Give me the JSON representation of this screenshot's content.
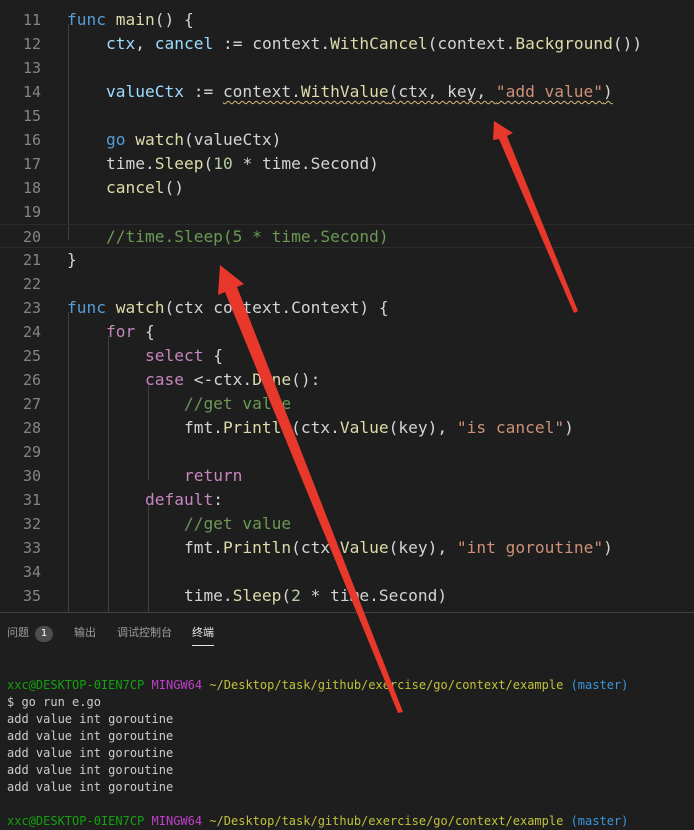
{
  "editor": {
    "lines": [
      {
        "num": "11",
        "tokens": [
          [
            "func",
            "kw"
          ],
          [
            " ",
            "pl"
          ],
          [
            "main",
            "fn"
          ],
          [
            "() {",
            "pl"
          ]
        ]
      },
      {
        "num": "12",
        "tokens": [
          [
            "    ",
            "pl"
          ],
          [
            "ctx",
            "var"
          ],
          [
            ", ",
            "pl"
          ],
          [
            "cancel",
            "var"
          ],
          [
            " := context.",
            "pl"
          ],
          [
            "WithCancel",
            "fn"
          ],
          [
            "(context.",
            "pl"
          ],
          [
            "Background",
            "fn"
          ],
          [
            "())",
            "pl"
          ]
        ]
      },
      {
        "num": "13",
        "tokens": []
      },
      {
        "num": "14",
        "tokens": [
          [
            "    ",
            "pl"
          ],
          [
            "valueCtx",
            "var"
          ],
          [
            " := ",
            "pl"
          ],
          [
            "context.",
            "pl",
            "squig"
          ],
          [
            "WithValue",
            "fn",
            "squig"
          ],
          [
            "(ctx, key, ",
            "pl",
            "squig"
          ],
          [
            "\"add value\"",
            "str",
            "squig"
          ],
          [
            ")",
            "pl",
            "squig"
          ]
        ]
      },
      {
        "num": "15",
        "tokens": []
      },
      {
        "num": "16",
        "tokens": [
          [
            "    ",
            "pl"
          ],
          [
            "go",
            "kw"
          ],
          [
            " ",
            "pl"
          ],
          [
            "watch",
            "fn"
          ],
          [
            "(valueCtx)",
            "pl"
          ]
        ]
      },
      {
        "num": "17",
        "tokens": [
          [
            "    time.",
            "pl"
          ],
          [
            "Sleep",
            "fn"
          ],
          [
            "(",
            "pl"
          ],
          [
            "10",
            "num"
          ],
          [
            " * time.Second)",
            "pl"
          ]
        ]
      },
      {
        "num": "18",
        "tokens": [
          [
            "    ",
            "pl"
          ],
          [
            "cancel",
            "fn"
          ],
          [
            "()",
            "pl"
          ]
        ]
      },
      {
        "num": "19",
        "tokens": []
      },
      {
        "num": "20",
        "tokens": [
          [
            "    //time.Sleep(5 * time.Second)",
            "cmt"
          ]
        ]
      },
      {
        "num": "21",
        "tokens": [
          [
            "}",
            "pl"
          ]
        ]
      },
      {
        "num": "22",
        "tokens": []
      },
      {
        "num": "23",
        "tokens": [
          [
            "func",
            "kw"
          ],
          [
            " ",
            "pl"
          ],
          [
            "watch",
            "fn"
          ],
          [
            "(ctx context.Context) {",
            "pl"
          ]
        ]
      },
      {
        "num": "24",
        "tokens": [
          [
            "    ",
            "pl"
          ],
          [
            "for",
            "ctl"
          ],
          [
            " {",
            "pl"
          ]
        ]
      },
      {
        "num": "25",
        "tokens": [
          [
            "        ",
            "pl"
          ],
          [
            "select",
            "ctl"
          ],
          [
            " {",
            "pl"
          ]
        ]
      },
      {
        "num": "26",
        "tokens": [
          [
            "        ",
            "pl"
          ],
          [
            "case",
            "ctl"
          ],
          [
            " <-ctx.",
            "pl"
          ],
          [
            "Done",
            "fn"
          ],
          [
            "():",
            "pl"
          ]
        ]
      },
      {
        "num": "27",
        "tokens": [
          [
            "            //get value",
            "cmt"
          ]
        ]
      },
      {
        "num": "28",
        "tokens": [
          [
            "            fmt.",
            "pl"
          ],
          [
            "Println",
            "fn"
          ],
          [
            "(ctx.",
            "pl"
          ],
          [
            "Value",
            "fn"
          ],
          [
            "(key), ",
            "pl"
          ],
          [
            "\"is cancel\"",
            "str"
          ],
          [
            ")",
            "pl"
          ]
        ]
      },
      {
        "num": "29",
        "tokens": []
      },
      {
        "num": "30",
        "tokens": [
          [
            "            ",
            "pl"
          ],
          [
            "return",
            "ctl"
          ]
        ]
      },
      {
        "num": "31",
        "tokens": [
          [
            "        ",
            "pl"
          ],
          [
            "default",
            "ctl"
          ],
          [
            ":",
            "pl"
          ]
        ]
      },
      {
        "num": "32",
        "tokens": [
          [
            "            //get value",
            "cmt"
          ]
        ]
      },
      {
        "num": "33",
        "tokens": [
          [
            "            fmt.",
            "pl"
          ],
          [
            "Println",
            "fn"
          ],
          [
            "(ctx.",
            "pl"
          ],
          [
            "Value",
            "fn"
          ],
          [
            "(key), ",
            "pl"
          ],
          [
            "\"int goroutine\"",
            "str"
          ],
          [
            ")",
            "pl"
          ]
        ]
      },
      {
        "num": "34",
        "tokens": []
      },
      {
        "num": "35",
        "tokens": [
          [
            "            time.",
            "pl"
          ],
          [
            "Sleep",
            "fn"
          ],
          [
            "(",
            "pl"
          ],
          [
            "2",
            "num"
          ],
          [
            " * time.Second)",
            "pl"
          ]
        ]
      }
    ],
    "current_line": "20"
  },
  "panel": {
    "tabs": [
      {
        "label": "问题",
        "badge": "1",
        "active": false
      },
      {
        "label": "输出",
        "active": false
      },
      {
        "label": "调试控制台",
        "active": false
      },
      {
        "label": "终端",
        "active": true
      }
    ],
    "terminal": {
      "prompt": {
        "user": "xxc@DESKTOP-0IEN7CP",
        "env": "MINGW64",
        "path": "~/Desktop/task/github/exercise/go/context/example",
        "branch": "(master)"
      },
      "command": "$ go run e.go",
      "output": [
        "add value int goroutine",
        "add value int goroutine",
        "add value int goroutine",
        "add value int goroutine",
        "add value int goroutine"
      ]
    }
  },
  "colors": {
    "annotation_arrow": "#e8382c"
  }
}
